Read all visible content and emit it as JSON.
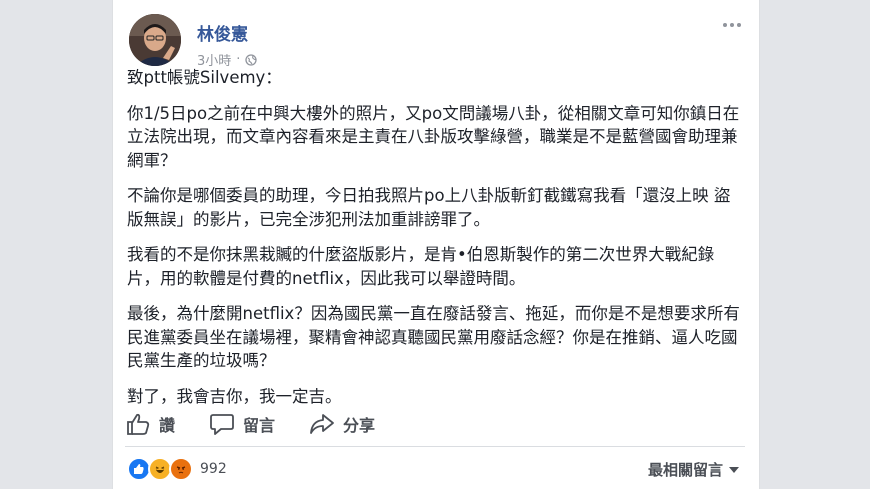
{
  "post": {
    "author": "林俊憲",
    "time": "3小時",
    "privacy_icon": "globe-icon",
    "more_icon": "more-options-icon",
    "salutation": "致ptt帳號Silvemy：",
    "paragraphs": [
      "你1/5日po之前在中興大樓外的照片，又po文問議場八卦，從相關文章可知你鎮日在立法院出現，而文章內容看來是主責在八卦版攻擊綠營，職業是不是藍營國會助理兼網軍？",
      "不論你是哪個委員的助理，今日拍我照片po上八卦版斬釘截鐵寫我看「還沒上映 盜版無誤」的影片，已完全涉犯刑法加重誹謗罪了。",
      "我看的不是你抹黑栽贓的什麼盜版影片，是肯•伯恩斯製作的第二次世界大戰紀錄片，用的軟體是付費的netflix，因此我可以舉證時間。",
      "最後，為什麼開netflix？因為國民黨一直在廢話發言、拖延，而你是不是想要求所有民進黨委員坐在議場裡，聚精會神認真聽國民黨用廢話念經？你是在推銷、逼人吃國民黨生產的垃圾嗎？",
      "對了，我會吉你，我一定吉。"
    ]
  },
  "actions": {
    "like_label": "讚",
    "comment_label": "留言",
    "share_label": "分享"
  },
  "reactions": {
    "count": "992",
    "icons": [
      "like-reaction-icon",
      "haha-reaction-icon",
      "angry-reaction-icon"
    ],
    "colors": {
      "like": "#1877f2",
      "haha": "#f7b125",
      "angry": "#e9710f"
    }
  },
  "comments_sort": {
    "label": "最相關留言"
  },
  "theme": {
    "author_color": "#365899",
    "text_color": "#1d2129",
    "muted_color": "#90949c"
  }
}
